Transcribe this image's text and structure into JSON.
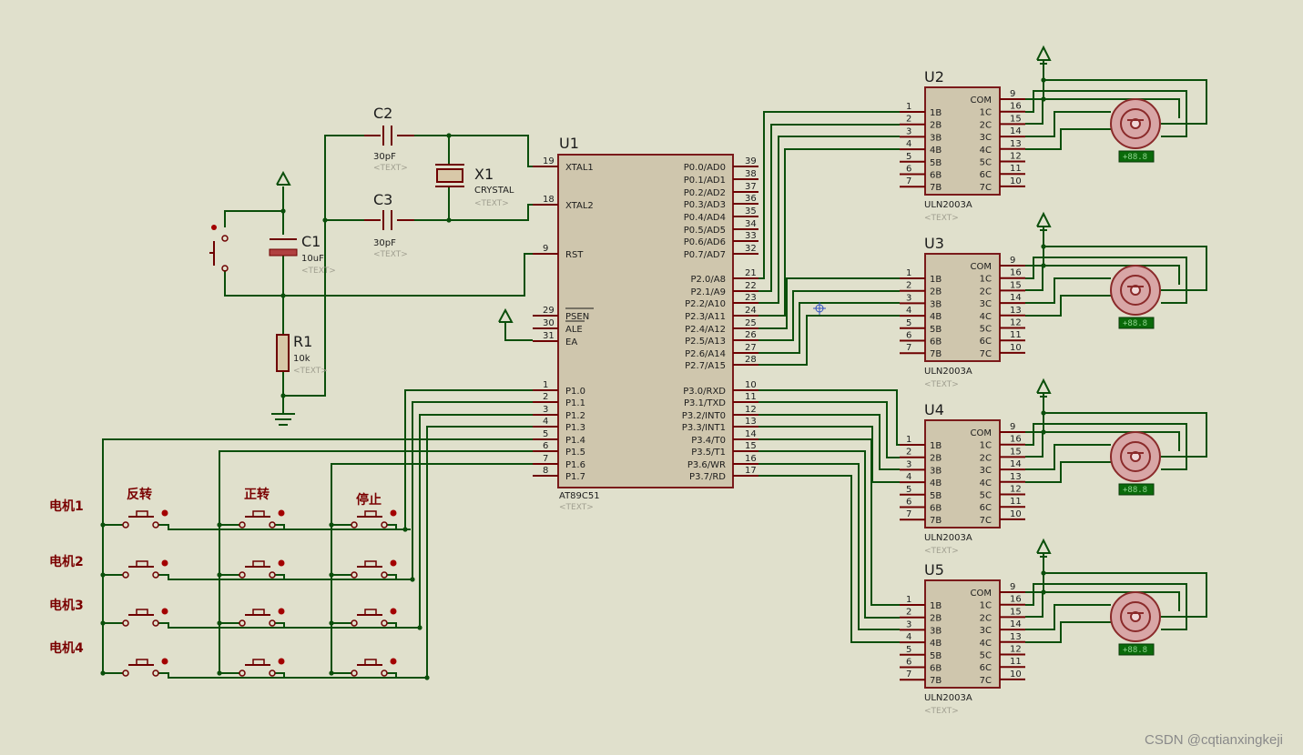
{
  "mcu": {
    "ref": "U1",
    "part": "AT89C51",
    "text": "<TEXT>",
    "left_pins": [
      {
        "num": "19",
        "label": "XTAL1"
      },
      {
        "num": "18",
        "label": "XTAL2"
      },
      {
        "num": "9",
        "label": "RST"
      },
      {
        "num": "29",
        "label": "PSEN"
      },
      {
        "num": "30",
        "label": "ALE"
      },
      {
        "num": "31",
        "label": "EA"
      },
      {
        "num": "1",
        "label": "P1.0"
      },
      {
        "num": "2",
        "label": "P1.1"
      },
      {
        "num": "3",
        "label": "P1.2"
      },
      {
        "num": "4",
        "label": "P1.3"
      },
      {
        "num": "5",
        "label": "P1.4"
      },
      {
        "num": "6",
        "label": "P1.5"
      },
      {
        "num": "7",
        "label": "P1.6"
      },
      {
        "num": "8",
        "label": "P1.7"
      }
    ],
    "right_pins": [
      {
        "num": "39",
        "label": "P0.0/AD0"
      },
      {
        "num": "38",
        "label": "P0.1/AD1"
      },
      {
        "num": "37",
        "label": "P0.2/AD2"
      },
      {
        "num": "36",
        "label": "P0.3/AD3"
      },
      {
        "num": "35",
        "label": "P0.4/AD4"
      },
      {
        "num": "34",
        "label": "P0.5/AD5"
      },
      {
        "num": "33",
        "label": "P0.6/AD6"
      },
      {
        "num": "32",
        "label": "P0.7/AD7"
      },
      {
        "num": "21",
        "label": "P2.0/A8"
      },
      {
        "num": "22",
        "label": "P2.1/A9"
      },
      {
        "num": "23",
        "label": "P2.2/A10"
      },
      {
        "num": "24",
        "label": "P2.3/A11"
      },
      {
        "num": "25",
        "label": "P2.4/A12"
      },
      {
        "num": "26",
        "label": "P2.5/A13"
      },
      {
        "num": "27",
        "label": "P2.6/A14"
      },
      {
        "num": "28",
        "label": "P2.7/A15"
      },
      {
        "num": "10",
        "label": "P3.0/RXD"
      },
      {
        "num": "11",
        "label": "P3.1/TXD"
      },
      {
        "num": "12",
        "label": "P3.2/INT0"
      },
      {
        "num": "13",
        "label": "P3.3/INT1"
      },
      {
        "num": "14",
        "label": "P3.4/T0"
      },
      {
        "num": "15",
        "label": "P3.5/T1"
      },
      {
        "num": "16",
        "label": "P3.6/WR"
      },
      {
        "num": "17",
        "label": "P3.7/RD"
      }
    ]
  },
  "drivers": [
    {
      "ref": "U2",
      "part": "ULN2003A",
      "text": "<TEXT>"
    },
    {
      "ref": "U3",
      "part": "ULN2003A",
      "text": "<TEXT>"
    },
    {
      "ref": "U4",
      "part": "ULN2003A",
      "text": "<TEXT>"
    },
    {
      "ref": "U5",
      "part": "ULN2003A",
      "text": "<TEXT>"
    }
  ],
  "uln_left_pins": [
    {
      "num": "1",
      "label": "1B"
    },
    {
      "num": "2",
      "label": "2B"
    },
    {
      "num": "3",
      "label": "3B"
    },
    {
      "num": "4",
      "label": "4B"
    },
    {
      "num": "5",
      "label": "5B"
    },
    {
      "num": "6",
      "label": "6B"
    },
    {
      "num": "7",
      "label": "7B"
    }
  ],
  "uln_right_pins": [
    {
      "num": "9",
      "label": "COM"
    },
    {
      "num": "16",
      "label": "1C"
    },
    {
      "num": "15",
      "label": "2C"
    },
    {
      "num": "14",
      "label": "3C"
    },
    {
      "num": "13",
      "label": "4C"
    },
    {
      "num": "12",
      "label": "5C"
    },
    {
      "num": "11",
      "label": "6C"
    },
    {
      "num": "10",
      "label": "7C"
    }
  ],
  "motor_readout": "+88.8",
  "components": {
    "c1": {
      "ref": "C1",
      "value": "10uF",
      "text": "<TEXT>"
    },
    "c2": {
      "ref": "C2",
      "value": "30pF",
      "text": "<TEXT>"
    },
    "c3": {
      "ref": "C3",
      "value": "30pF",
      "text": "<TEXT>"
    },
    "x1": {
      "ref": "X1",
      "value": "CRYSTAL",
      "text": "<TEXT>"
    },
    "r1": {
      "ref": "R1",
      "value": "10k",
      "text": "<TEXT>"
    }
  },
  "button_columns": [
    "反转",
    "正转",
    "停止"
  ],
  "motor_rows": [
    "电机1",
    "电机2",
    "电机3",
    "电机4"
  ],
  "watermark": "CSDN @cqtianxingkeji",
  "colors": {
    "wire": "#0b4f0b",
    "pin": "#6e0000",
    "body": "#cfc6ad",
    "background": "#e0e0cc"
  }
}
